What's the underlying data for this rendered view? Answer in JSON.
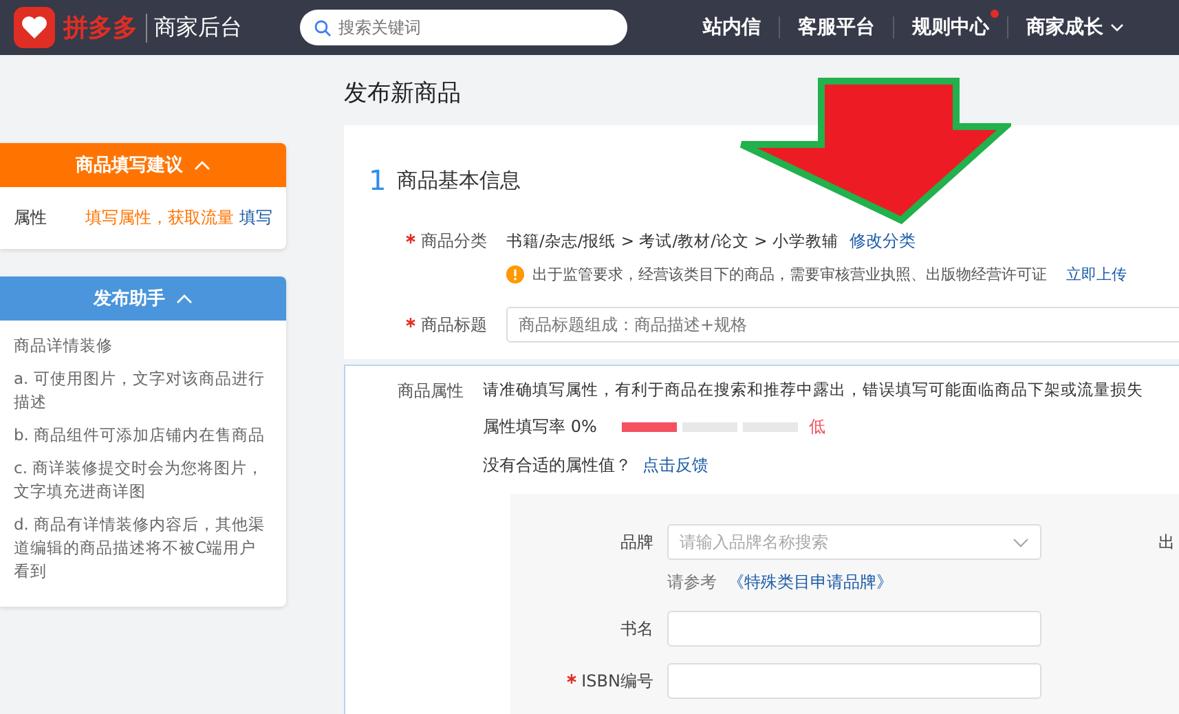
{
  "header": {
    "logo_text": "拼多多",
    "app_name": "商家后台",
    "search": {
      "placeholder": "搜索关键词"
    },
    "nav": [
      {
        "label": "站内信",
        "badge": false,
        "dropdown": false
      },
      {
        "label": "客服平台",
        "badge": false,
        "dropdown": false
      },
      {
        "label": "规则中心",
        "badge": true,
        "dropdown": false
      },
      {
        "label": "商家成长",
        "badge": false,
        "dropdown": true
      }
    ]
  },
  "sidebar": {
    "cards": [
      {
        "kind": "suggest",
        "title": "商品填写建议",
        "expanded": true,
        "rows": [
          {
            "label": "属性",
            "text": "填写属性，获取流量",
            "link": "填写"
          }
        ]
      },
      {
        "kind": "helper",
        "title": "发布助手",
        "expanded": true,
        "lines": [
          "商品详情装修",
          "a. 可使用图片，文字对该商品进行描述",
          "b. 商品组件可添加店铺内在售商品",
          "c. 商详装修提交时会为您将图片，文字填充进商详图",
          "d. 商品有详情装修内容后，其他渠道编辑的商品描述将不被C端用户看到"
        ]
      }
    ]
  },
  "page_title": "发布新商品",
  "section": {
    "number": "1",
    "title": "商品基本信息",
    "category": {
      "label": "商品分类",
      "required": true,
      "path": "书籍/杂志/报纸 > 考试/教材/论文 > 小学教辅",
      "link": "修改分类",
      "notice": "出于监管要求，经营该类目下的商品，需要审核营业执照、出版物经营许可证",
      "notice_link": "立即上传"
    },
    "title_field": {
      "label": "商品标题",
      "required": true,
      "placeholder": "商品标题组成：商品描述+规格"
    },
    "attributes": {
      "label": "商品属性",
      "hint": "请准确填写属性，有利于商品在搜索和推荐中露出，错误填写可能面临商品下架或流量损失",
      "rate_label": "属性填写率 0%",
      "level": 0.33,
      "rate_grade": "低",
      "feedback_text": "没有合适的属性值？",
      "feedback_link": "点击反馈",
      "fields": [
        {
          "kind": "select",
          "label": "品牌",
          "required": false,
          "placeholder": "请输入品牌名称搜索",
          "note": "请参考",
          "note_link": "《特殊类目申请品牌》"
        },
        {
          "kind": "text",
          "label": "书名",
          "required": false
        },
        {
          "kind": "text",
          "label": "ISBN编号",
          "required": true
        }
      ],
      "column_2_label": "出"
    }
  },
  "annotation": {
    "kind": "arrow"
  }
}
